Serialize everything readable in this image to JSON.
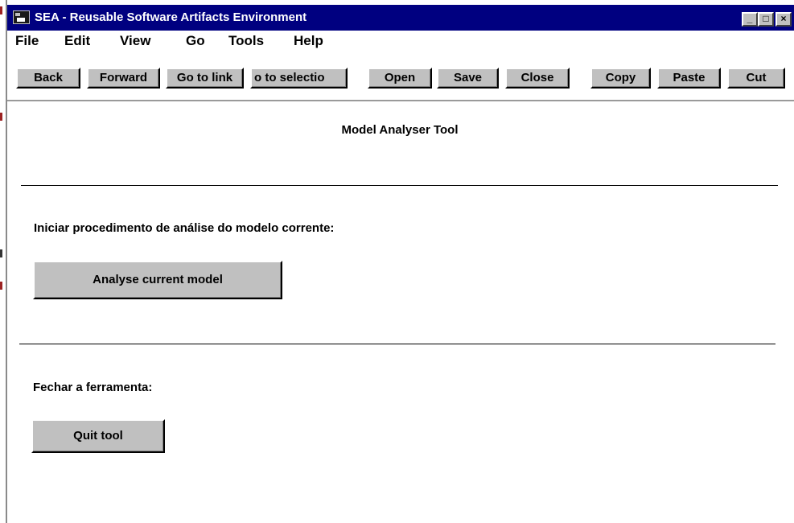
{
  "window": {
    "title": "SEA - Reusable Software Artifacts Environment",
    "controls": {
      "minimize": "_",
      "maximize": "□",
      "close": "×"
    }
  },
  "menu": {
    "items": [
      "File",
      "Edit",
      "View",
      "Go",
      "Tools",
      "Help"
    ]
  },
  "toolbar": {
    "back": "Back",
    "forward": "Forward",
    "go_to_link": "Go to link",
    "go_to_selection": "o to selectio",
    "open": "Open",
    "save": "Save",
    "close": "Close",
    "copy": "Copy",
    "paste": "Paste",
    "cut": "Cut"
  },
  "main": {
    "title": "Model Analyser Tool",
    "analyse_prompt": "Iniciar procedimento de análise do modelo corrente:",
    "analyse_button": "Analyse current model",
    "close_prompt": "Fechar a ferramenta:",
    "quit_button": "Quit tool"
  },
  "colors": {
    "titlebar": "#000080",
    "button_face": "#c0c0c0",
    "background": "#ffffff"
  },
  "icons": {
    "app": "app-window-icon"
  }
}
